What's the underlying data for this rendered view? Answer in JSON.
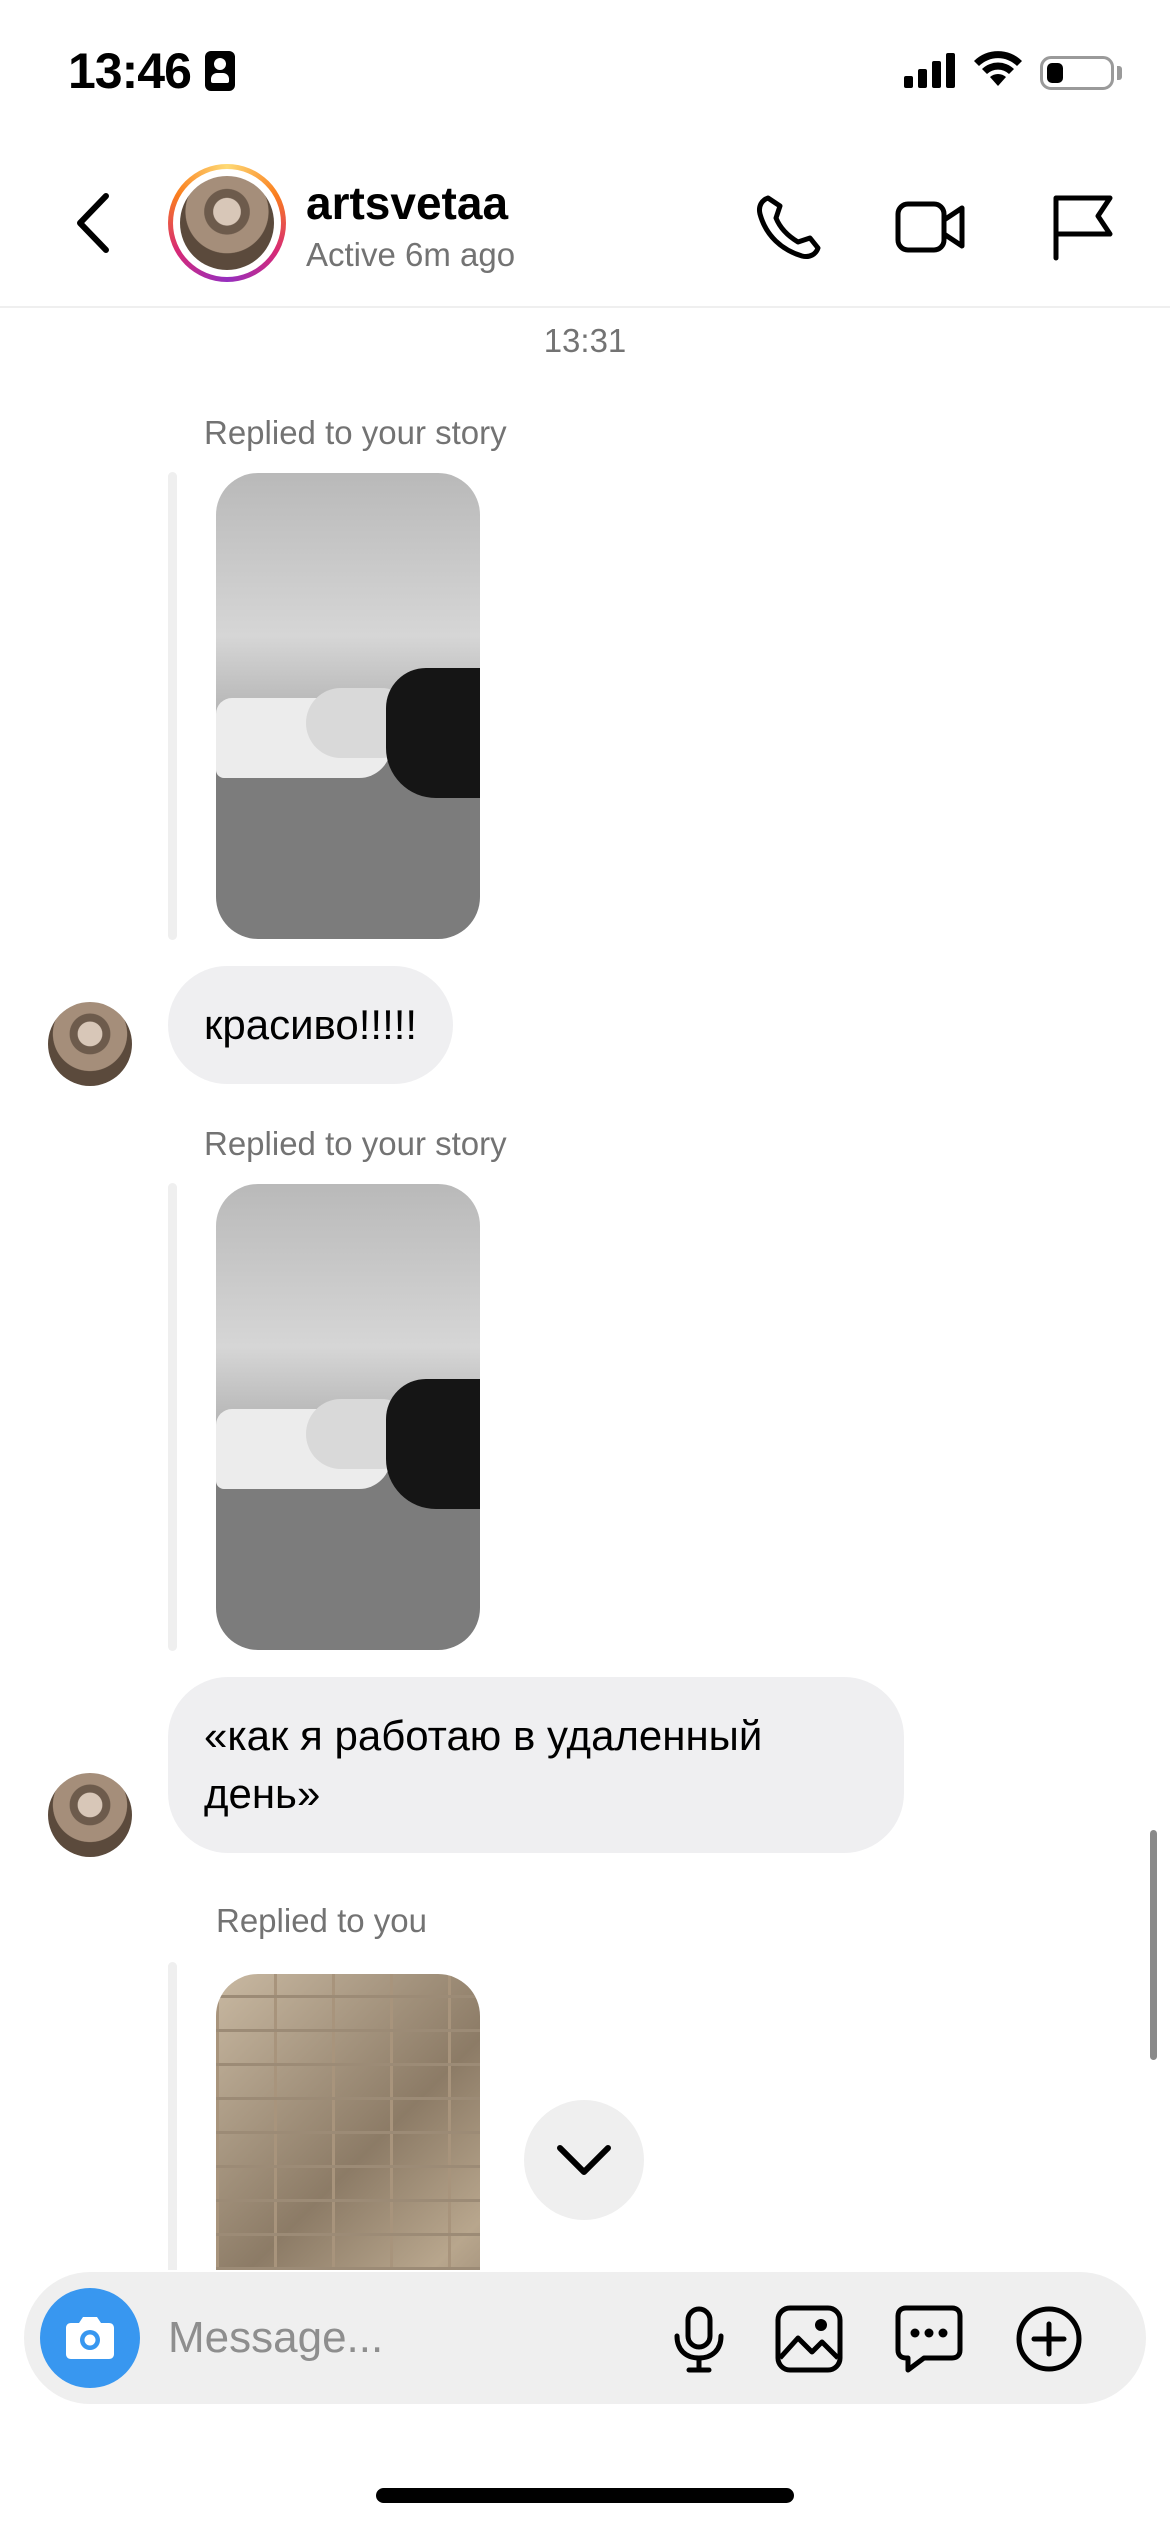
{
  "status_bar": {
    "time": "13:46",
    "battery_level": 0.25
  },
  "header": {
    "username": "artsvetaa",
    "active_status": "Active 6m ago",
    "icons": [
      "back-icon",
      "phone-icon",
      "video-camera-icon",
      "flag-icon"
    ]
  },
  "chat": {
    "timestamp": "13:31",
    "messages": [
      {
        "type": "story_reply",
        "caption": "Replied to your story"
      },
      {
        "type": "text",
        "text": "красиво!!!!!"
      },
      {
        "type": "story_reply",
        "caption": "Replied to your story"
      },
      {
        "type": "text",
        "text": "«как я работаю в удаленный день»"
      },
      {
        "type": "reply",
        "caption": "Replied to you"
      }
    ]
  },
  "composer": {
    "placeholder": "Message...",
    "icons": [
      "camera-icon",
      "microphone-icon",
      "gallery-icon",
      "sticker-icon",
      "plus-icon"
    ]
  },
  "colors": {
    "accent": "#3897f0",
    "bubble": "#efeff1",
    "secondary_text": "#737373"
  }
}
